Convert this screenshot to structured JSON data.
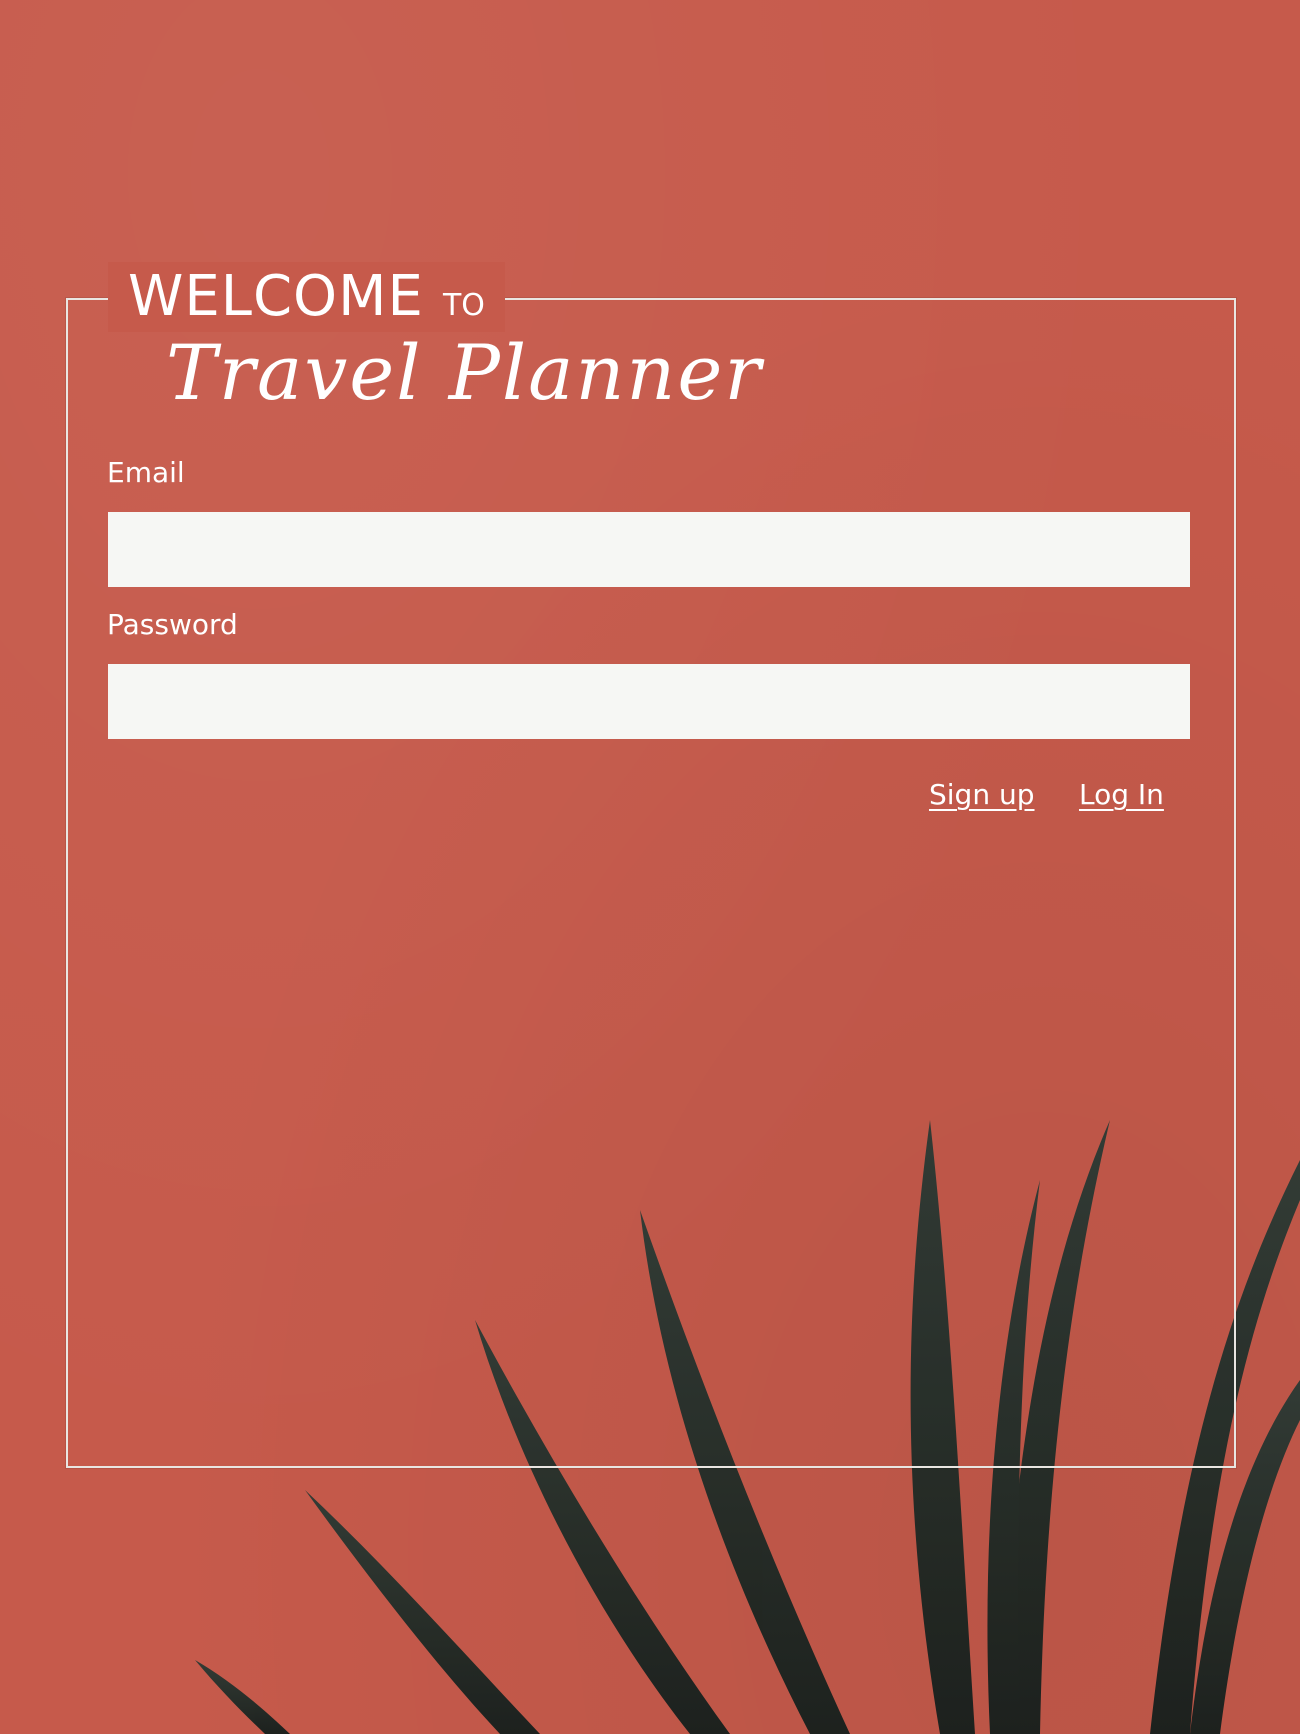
{
  "colors": {
    "background": "#c65a4b",
    "frame": "#e9e6e2",
    "input_bg": "#f6f7f4",
    "text": "#ffffff",
    "leaf": "#1f2e2a"
  },
  "header": {
    "welcome": "WELCOME",
    "to": "TO",
    "app_name": "Travel Planner"
  },
  "form": {
    "email_label": "Email",
    "email_value": "",
    "email_placeholder": "",
    "password_label": "Password",
    "password_value": "",
    "password_placeholder": ""
  },
  "actions": {
    "signup_label": "Sign up",
    "login_label": "Log In"
  },
  "decoration": {
    "image": "palm-leaves"
  }
}
